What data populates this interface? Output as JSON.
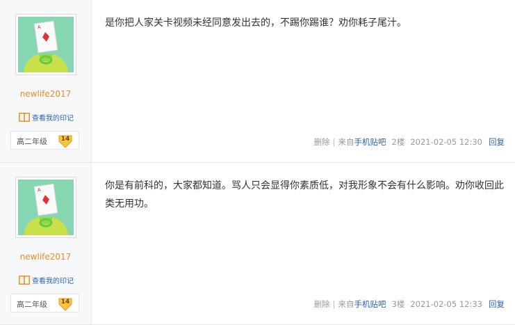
{
  "posts": [
    {
      "username": "newlife2017",
      "seal_link": "查看我的印记",
      "level_name": "高二年级",
      "level_num": "14",
      "content": "是你把人家关卡视频未经同意发出去的，不踢你踢谁？劝你耗子尾汁。",
      "delete": "删除",
      "separator": "|",
      "from_prefix": "来自",
      "source": "手机贴吧",
      "floor": "2楼",
      "time": "2021-02-05 12:30",
      "reply": "回复"
    },
    {
      "username": "newlife2017",
      "seal_link": "查看我的印记",
      "level_name": "高二年级",
      "level_num": "14",
      "content": "你是有前科的，大家都知道。骂人只会显得你素质低，对我形象不会有什么影响。劝你收回此类无用功。",
      "delete": "删除",
      "separator": "|",
      "from_prefix": "来自",
      "source": "手机贴吧",
      "floor": "3楼",
      "time": "2021-02-05 12:33",
      "reply": "回复"
    }
  ],
  "colors": {
    "username": "#f08a24",
    "link": "#2d64b3",
    "meta": "#999999",
    "sidebar_bg": "#f7f8fa"
  }
}
